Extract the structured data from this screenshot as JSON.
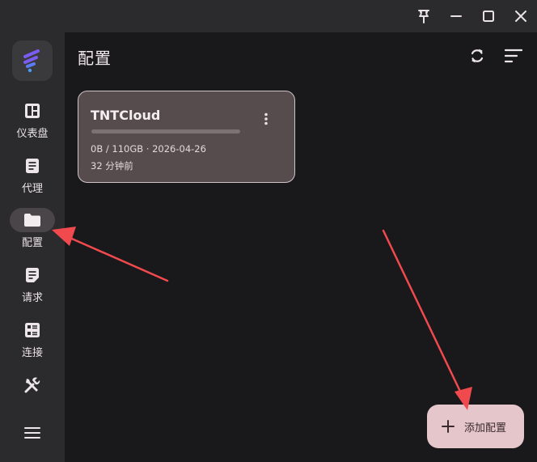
{
  "app": {
    "accent": "#e4c6cb",
    "annotation_color": "#f04a4f"
  },
  "titlebar": {
    "icons": [
      "pin-icon",
      "minimize-icon",
      "maximize-icon",
      "close-icon"
    ]
  },
  "sidebar": {
    "items": [
      {
        "label": "仪表盘",
        "icon": "dashboard-icon",
        "active": false
      },
      {
        "label": "代理",
        "icon": "proxy-icon",
        "active": false
      },
      {
        "label": "配置",
        "icon": "folder-icon",
        "active": true
      },
      {
        "label": "请求",
        "icon": "request-icon",
        "active": false
      },
      {
        "label": "连接",
        "icon": "connection-icon",
        "active": false
      },
      {
        "label": "",
        "icon": "tools-icon",
        "active": false
      }
    ]
  },
  "main": {
    "title": "配置"
  },
  "profiles": [
    {
      "name": "TNTCloud",
      "usage": "0B / 110GB · 2026-04-26",
      "updated": "32 分钟前",
      "used_fraction": 0
    }
  ],
  "fab": {
    "label": "添加配置"
  }
}
